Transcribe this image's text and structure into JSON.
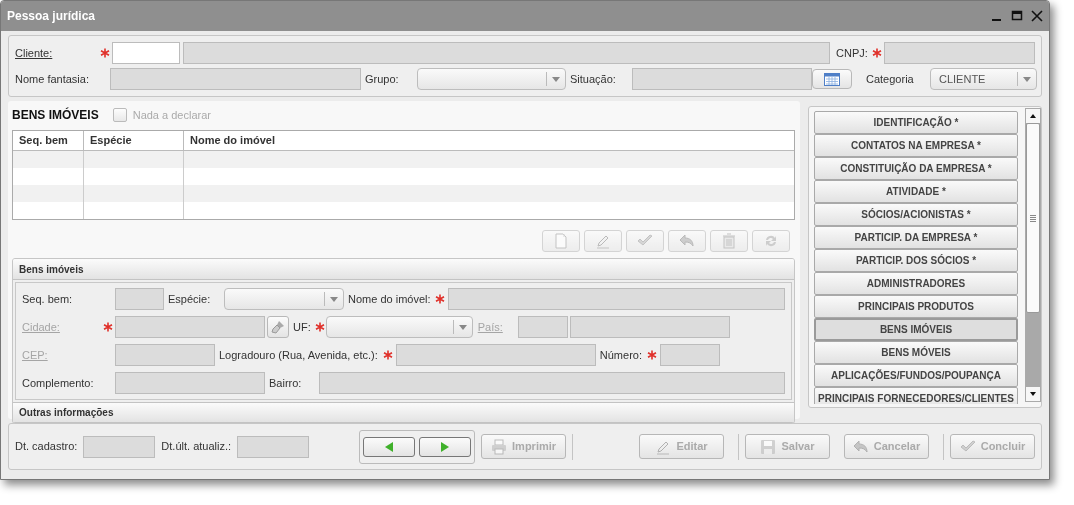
{
  "window": {
    "title": "Pessoa jurídica"
  },
  "header": {
    "cliente": {
      "label": "Cliente:",
      "link": true,
      "required": true
    },
    "cnpj": {
      "label": "CNPJ:",
      "required": true
    },
    "nome_fantasia": {
      "label": "Nome fantasia:"
    },
    "grupo": {
      "label": "Grupo:"
    },
    "situacao": {
      "label": "Situação:"
    },
    "categoria": {
      "label": "Categoria",
      "value": "CLIENTE"
    }
  },
  "section": {
    "title": "BENS IMÓVEIS",
    "nada_a_declarar": {
      "label": "Nada a declarar",
      "checked": false,
      "disabled": true
    }
  },
  "table": {
    "columns": [
      "Seq. bem",
      "Espécie",
      "Nome do imóvel"
    ]
  },
  "table_toolbar": [
    {
      "kind": "new",
      "disabled": true
    },
    {
      "kind": "edit",
      "disabled": true
    },
    {
      "kind": "confirm",
      "disabled": true
    },
    {
      "kind": "undo",
      "disabled": true
    },
    {
      "kind": "delete",
      "disabled": true
    },
    {
      "kind": "refresh",
      "disabled": true
    }
  ],
  "form": {
    "title": "Bens imóveis",
    "seq_bem": {
      "label": "Seq. bem:"
    },
    "especie": {
      "label": "Espécie:"
    },
    "nome_imovel": {
      "label": "Nome do imóvel:",
      "required": true
    },
    "cidade": {
      "label": "Cidade:",
      "link": true,
      "disabled": true,
      "required": true
    },
    "uf": {
      "label": "UF:",
      "required": true
    },
    "pais": {
      "label": "País:",
      "link": true,
      "disabled": true
    },
    "cep": {
      "label": "CEP:",
      "link": true,
      "disabled": true
    },
    "logradouro": {
      "label": "Logradouro (Rua, Avenida, etc.):",
      "required": true
    },
    "numero": {
      "label": "Número:",
      "required": true
    },
    "complemento": {
      "label": "Complemento:"
    },
    "bairro": {
      "label": "Bairro:"
    }
  },
  "other_section": {
    "title": "Outras informações"
  },
  "nav": [
    {
      "label": "IDENTIFICAÇÃO *",
      "selected": false
    },
    {
      "label": "CONTATOS NA EMPRESA *",
      "selected": false
    },
    {
      "label": "CONSTITUIÇÃO DA EMPRESA *",
      "selected": false
    },
    {
      "label": "ATIVIDADE *",
      "selected": false
    },
    {
      "label": "SÓCIOS/ACIONISTAS *",
      "selected": false
    },
    {
      "label": "PARTICIP. DA EMPRESA *",
      "selected": false
    },
    {
      "label": "PARTICIP. DOS SÓCIOS *",
      "selected": false
    },
    {
      "label": "ADMINISTRADORES",
      "selected": false
    },
    {
      "label": "PRINCIPAIS PRODUTOS",
      "selected": false
    },
    {
      "label": "BENS IMÓVEIS",
      "selected": true
    },
    {
      "label": "BENS MÓVEIS",
      "selected": false
    },
    {
      "label": "APLICAÇÕES/FUNDOS/POUPANÇA",
      "selected": false
    },
    {
      "label": "PRINCIPAIS FORNECEDORES/CLIENTES",
      "selected": false
    }
  ],
  "footer": {
    "dt_cadastro": {
      "label": "Dt. cadastro:"
    },
    "dt_atualiz": {
      "label": "Dt.últ. atualiz.:"
    },
    "buttons": [
      {
        "kind": "print",
        "label": "Imprimir",
        "disabled": true
      },
      {
        "kind": "edit",
        "label": "Editar",
        "disabled": true
      },
      {
        "kind": "save",
        "label": "Salvar",
        "disabled": true
      },
      {
        "kind": "cancel",
        "label": "Cancelar",
        "disabled": true
      },
      {
        "kind": "finish",
        "label": "Concluir",
        "disabled": true
      }
    ]
  }
}
